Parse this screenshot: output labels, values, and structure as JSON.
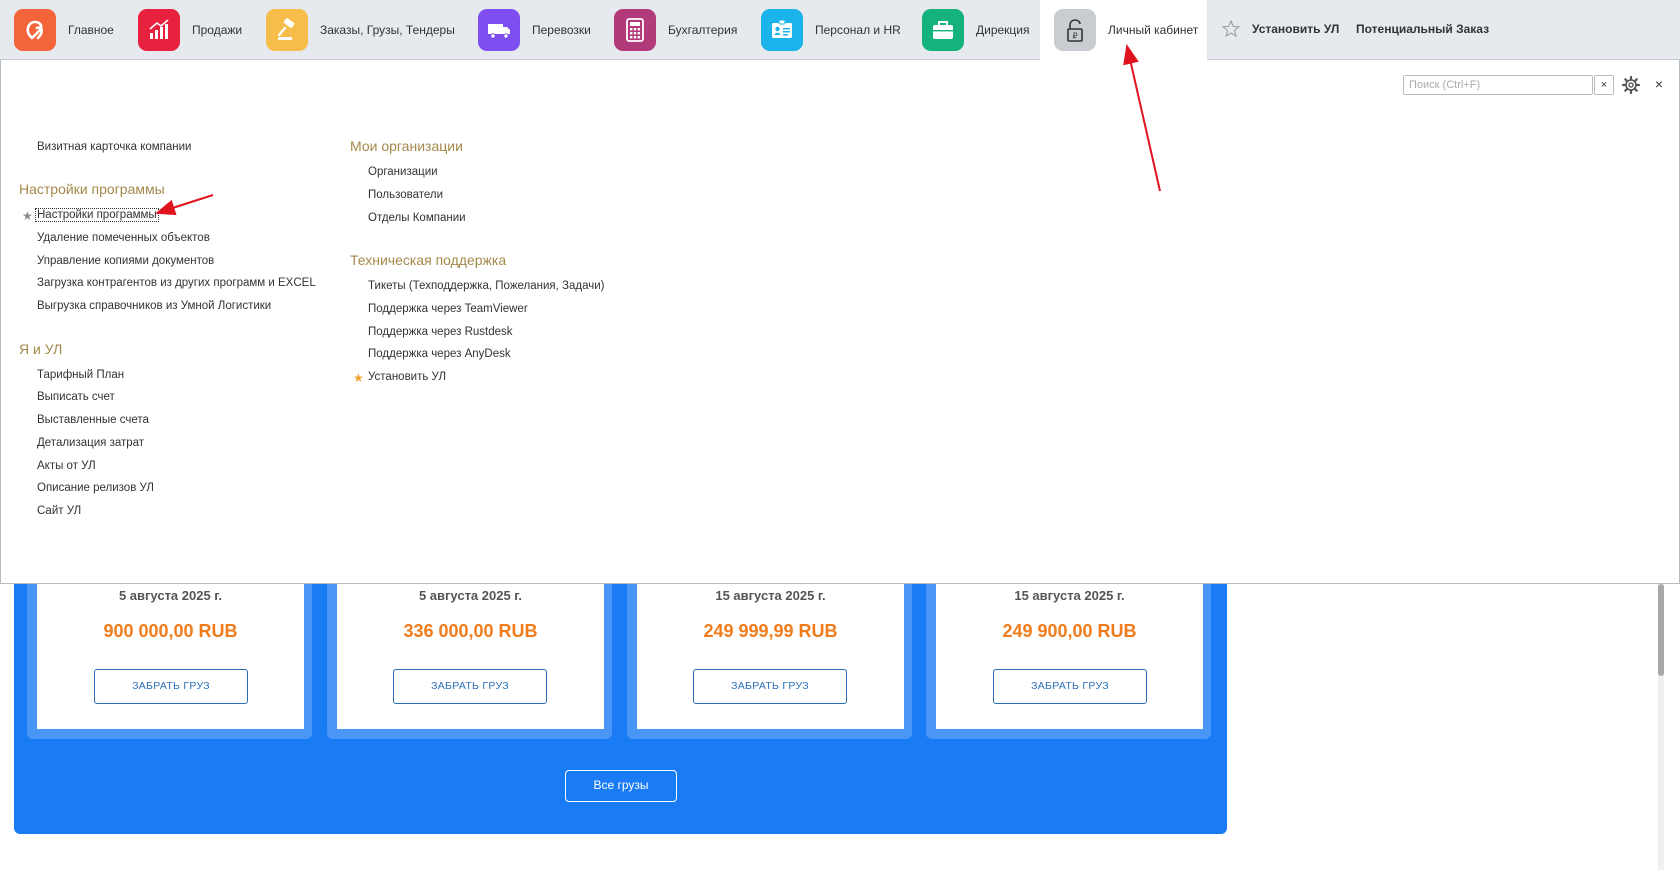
{
  "nav": {
    "items": [
      {
        "label": "Главное",
        "icon": "logo-icon",
        "color": "#f3643b"
      },
      {
        "label": "Продажи",
        "icon": "sales-chart-icon",
        "color": "#e8213f"
      },
      {
        "label": "Заказы,  Грузы, Тендеры",
        "icon": "gavel-icon",
        "color": "#f6bd4a"
      },
      {
        "label": "Перевозки",
        "icon": "truck-icon",
        "color": "#7e4ef1"
      },
      {
        "label": "Бухгалтерия",
        "icon": "calculator-icon",
        "color": "#b23a7a"
      },
      {
        "label": "Персонал и HR",
        "icon": "id-card-icon",
        "color": "#1bb4ea"
      },
      {
        "label": "Дирекция",
        "icon": "briefcase-icon",
        "color": "#16b27d"
      },
      {
        "label": "Личный кабинет",
        "icon": "lock-icon",
        "color": "#c9ccd0"
      }
    ],
    "install_link": "Установить УЛ",
    "potential_order_link": "Потенциальный Заказ"
  },
  "search": {
    "placeholder": "Поиск (Ctrl+F)",
    "clear": "×"
  },
  "close_label": "×",
  "menu": {
    "col1": {
      "business_card": "Визитная карточка компании",
      "settings_title": "Настройки программы",
      "settings_items": [
        "Настройки программы",
        "Удаление помеченных объектов",
        "Управление копиями документов",
        "Загрузка контрагентов из других программ и EXCEL",
        "Выгрузка справочников из Умной Логистики"
      ],
      "me_title": "Я и УЛ",
      "me_items": [
        "Тарифный План",
        "Выписать счет",
        "Выставленные счета",
        "Детализация затрат",
        "Акты от УЛ",
        "Описание релизов УЛ",
        "Сайт УЛ"
      ]
    },
    "col2": {
      "orgs_title": "Мои организации",
      "orgs_items": [
        "Организации",
        "Пользователи",
        "Отделы Компании"
      ],
      "support_title": "Техническая поддержка",
      "support_items": [
        "Тикеты (Техподдержка, Пожелания, Задачи)",
        "Поддержка через TeamViewer",
        "Поддержка через Rustdesk",
        "Поддержка через AnyDesk",
        "Установить УЛ"
      ]
    }
  },
  "cards": [
    {
      "date": "5 августа 2025 г.",
      "price": "900 000,00 RUB",
      "button": "ЗАБРАТЬ ГРУЗ"
    },
    {
      "date": "5 августа 2025 г.",
      "price": "336 000,00 RUB",
      "button": "ЗАБРАТЬ ГРУЗ"
    },
    {
      "date": "15 августа 2025 г.",
      "price": "249 999,99 RUB",
      "button": "ЗАБРАТЬ ГРУЗ"
    },
    {
      "date": "15 августа 2025 г.",
      "price": "249 900,00 RUB",
      "button": "ЗАБРАТЬ ГРУЗ"
    }
  ],
  "all_cargo_button": "Все грузы",
  "colors": {
    "accent_blue": "#1a7cf5",
    "section_title": "#a5894a",
    "price_orange": "#f07c1c",
    "annotation_red": "#e0141e",
    "star_gold": "#f3a531",
    "star_gray": "#8a8a8a"
  }
}
